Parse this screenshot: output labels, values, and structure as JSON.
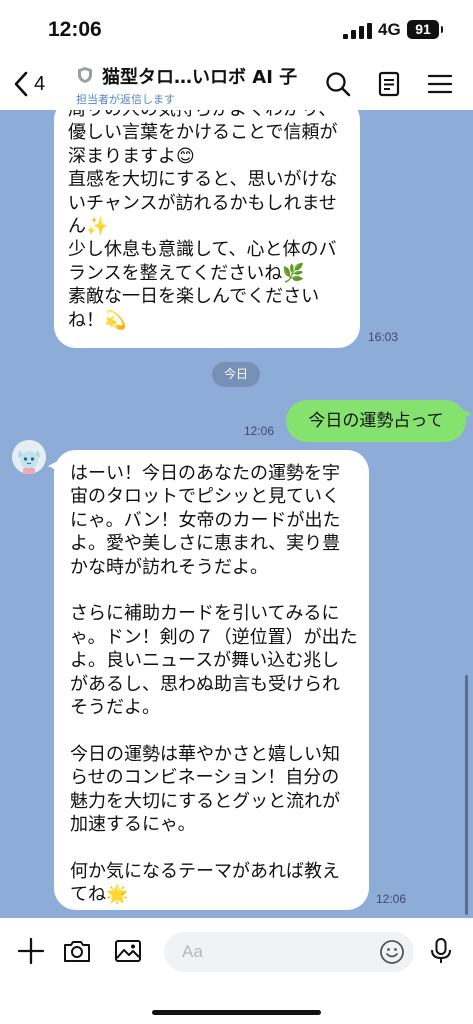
{
  "status_bar": {
    "time": "12:06",
    "network": "4G",
    "battery": "91"
  },
  "header": {
    "back_count": "4",
    "title": "猫型タロ…いロボ AI 子",
    "subtitle": "担当者が返信します"
  },
  "messages": {
    "prev_text": "周りの人の気持ちがよくわかり、\n優しい言葉をかけることで信頼が\n深まりますよ😊\n直感を大切にすると、思いがけな\nいチャンスが訪れるかもしれませ\nん✨\n少し休息も意識して、心と体のバ\nランスを整えてくださいね🌿\n素敵な一日を楽しんでください\nね！💫",
    "prev_time": "16:03",
    "date_separator": "今日",
    "sent_text": "今日の運勢占って",
    "sent_time": "12:06",
    "reply_text": "はーい！今日のあなたの運勢を宇\n宙のタロットでピシッと見ていく\nにゃ。バン！女帝のカードが出た\nよ。愛や美しさに恵まれ、実り豊\nかな時が訪れそうだよ。\n\nさらに補助カードを引いてみるに\nゃ。ドン！剣の７（逆位置）が出た\nよ。良いニュースが舞い込む兆し\nがあるし、思わぬ助言も受けられ\nそうだよ。\n\n今日の運勢は華やかさと嬉しい知\nらせのコンビネーション！自分の\n魅力を大切にするとグッと流れが\n加速するにゃ。\n\n何か気になるテーマがあれば教え\nてね🌟",
    "reply_time": "12:06"
  },
  "input": {
    "placeholder": "Aa"
  },
  "colors": {
    "chat_bg": "#8eacd8",
    "sent_bubble": "#86e26e",
    "date_pill": "#7790b6"
  }
}
